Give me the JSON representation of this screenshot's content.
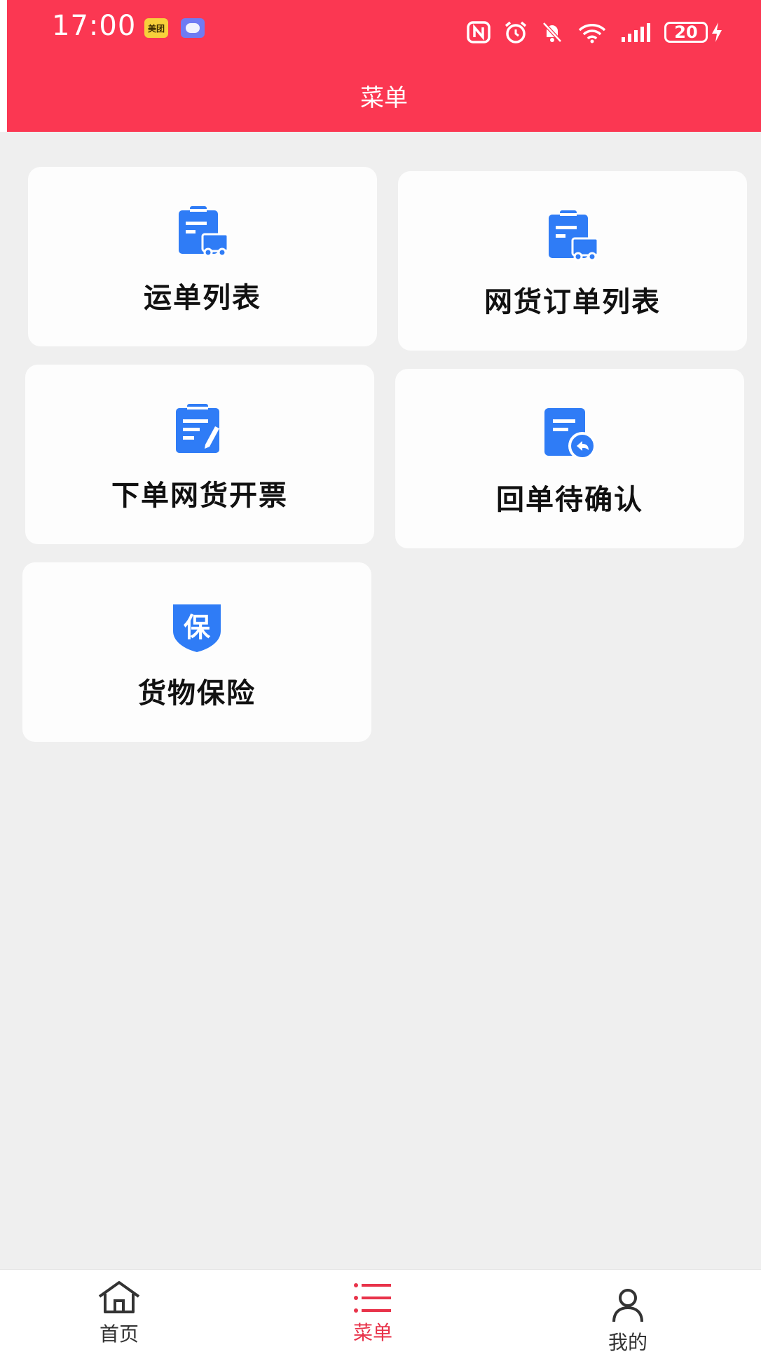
{
  "status_bar": {
    "time": "17:00",
    "meituan_badge": "美团",
    "battery_level": "20"
  },
  "header": {
    "title": "菜单",
    "background_color": "#fb3752"
  },
  "menu": {
    "items": [
      {
        "label": "运单列表",
        "icon": "clipboard-truck-icon"
      },
      {
        "label": "网货订单列表",
        "icon": "clipboard-truck-icon"
      },
      {
        "label": "下单网货开票",
        "icon": "clipboard-edit-icon"
      },
      {
        "label": "回单待确认",
        "icon": "document-return-icon"
      },
      {
        "label": "货物保险",
        "icon": "insurance-shield-icon",
        "icon_text": "保"
      }
    ],
    "icon_color": "#2f7cf6"
  },
  "bottom_nav": {
    "items": [
      {
        "label": "首页",
        "icon": "home-icon",
        "active": false
      },
      {
        "label": "菜单",
        "icon": "list-icon",
        "active": true
      },
      {
        "label": "我的",
        "icon": "user-icon",
        "active": false
      }
    ],
    "active_color": "#e8334a"
  }
}
